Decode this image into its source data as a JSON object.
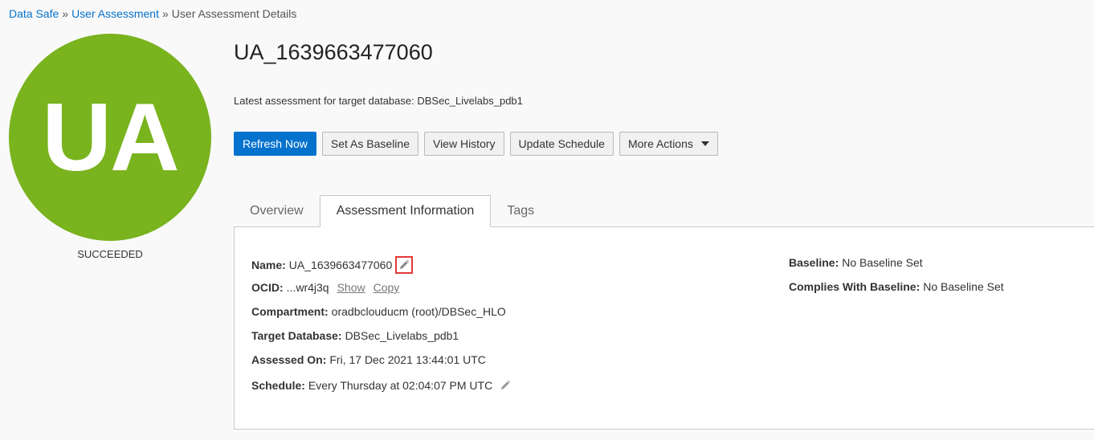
{
  "breadcrumb": {
    "items": [
      "Data Safe",
      "User Assessment",
      "User Assessment Details"
    ],
    "separator": "»"
  },
  "avatar": {
    "initials": "UA",
    "color": "#79b31e"
  },
  "status": "SUCCEEDED",
  "title": "UA_1639663477060",
  "subtitle": "Latest assessment for target database: DBSec_Livelabs_pdb1",
  "actions": {
    "refresh": "Refresh Now",
    "baseline": "Set As Baseline",
    "history": "View History",
    "schedule": "Update Schedule",
    "more": "More Actions"
  },
  "tabs": [
    "Overview",
    "Assessment Information",
    "Tags"
  ],
  "info": {
    "name_label": "Name:",
    "name_value": "UA_1639663477060",
    "ocid_label": "OCID:",
    "ocid_value": "...wr4j3q",
    "show": "Show",
    "copy": "Copy",
    "compartment_label": "Compartment:",
    "compartment_value": "oradbclouducm (root)/DBSec_HLO",
    "target_label": "Target Database:",
    "target_value": "DBSec_Livelabs_pdb1",
    "assessed_label": "Assessed On:",
    "assessed_value": "Fri, 17 Dec 2021 13:44:01 UTC",
    "schedule_label": "Schedule:",
    "schedule_value": "Every Thursday at 02:04:07 PM UTC",
    "baseline_label": "Baseline:",
    "baseline_value": "No Baseline Set",
    "complies_label": "Complies With Baseline:",
    "complies_value": "No Baseline Set"
  },
  "colors": {
    "primary": "#0572ce",
    "avatar": "#79b31e",
    "highlight": "#e03a3a"
  }
}
